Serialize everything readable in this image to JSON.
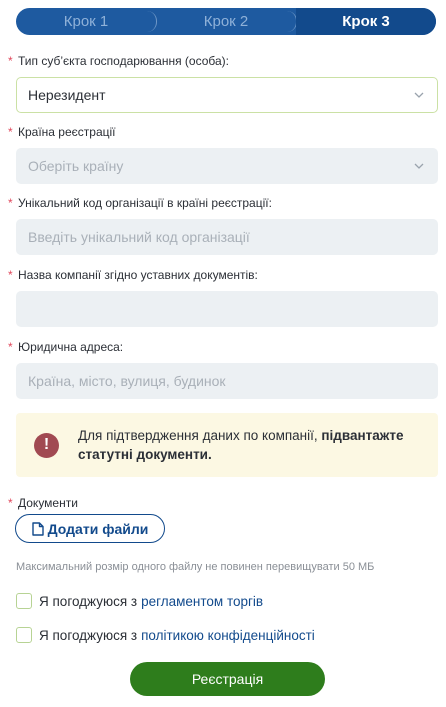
{
  "stepper": {
    "steps": [
      "Крок 1",
      "Крок 2",
      "Крок 3"
    ],
    "active_index": 2
  },
  "fields": {
    "entity_type": {
      "label": "Тип суб’єкта господарювання (особа):",
      "value": "Нерезидент"
    },
    "country": {
      "label": "Країна реєстрації",
      "placeholder": "Оберіть країну"
    },
    "org_code": {
      "label": "Унікальний код організації в країні реєстрації:",
      "placeholder": "Введіть унікальний код організації"
    },
    "company_name": {
      "label": "Назва компанії згідно уставних документів:",
      "placeholder": ""
    },
    "address": {
      "label": "Юридична адреса:",
      "placeholder": "Країна, місто, вулиця, будинок"
    }
  },
  "notice": {
    "text": "Для підтвердження даних по компанії,",
    "bold": "підвантажте статутні документи."
  },
  "documents": {
    "label": "Документи",
    "add_button": "Додати файли",
    "hint": "Максимальний розмір одного файлу не повинен перевищувати 50 МБ"
  },
  "agreements": [
    {
      "text": "Я погоджуюся з",
      "link": "регламентом торгів"
    },
    {
      "text": "Я погоджуюся з",
      "link": "політикою конфіденційності"
    }
  ],
  "submit_label": "Реєстрація",
  "colors": {
    "primary": "#124a8c",
    "success": "#2e7d1c",
    "required": "#e0475b",
    "notice_bg": "#fcf8e3"
  }
}
